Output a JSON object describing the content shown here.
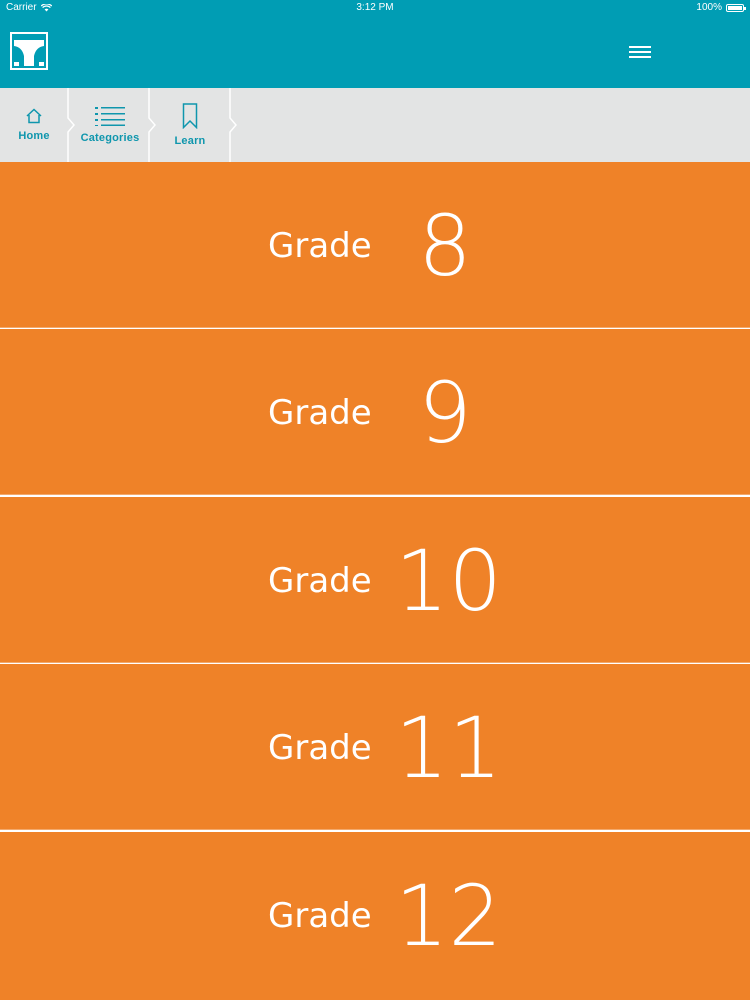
{
  "status": {
    "carrier": "Carrier",
    "time": "3:12 PM",
    "battery": "100%"
  },
  "header": {
    "logo_icon": "bridge-logo-icon",
    "menu_icon": "hamburger-icon"
  },
  "breadcrumb": {
    "items": [
      {
        "label": "Home",
        "icon": "home-icon"
      },
      {
        "label": "Categories",
        "icon": "list-icon"
      },
      {
        "label": "Learn",
        "icon": "bookmark-icon"
      }
    ]
  },
  "grades": [
    {
      "word": "Grade",
      "number": "8"
    },
    {
      "word": "Grade",
      "number": "9"
    },
    {
      "word": "Grade",
      "number": "10"
    },
    {
      "word": "Grade",
      "number": "11"
    },
    {
      "word": "Grade",
      "number": "12"
    }
  ],
  "colors": {
    "header": "#009db4",
    "breadcrumb_bg": "#e3e4e4",
    "accent_text": "#0f96ad",
    "grade_row": "#ef8228"
  }
}
